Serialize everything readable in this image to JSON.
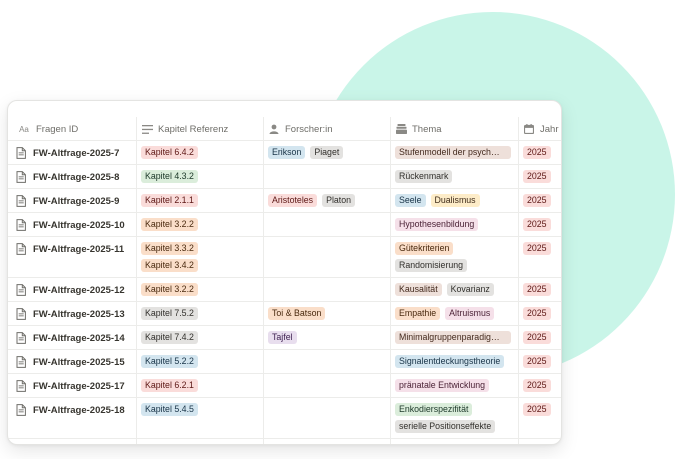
{
  "colors": {
    "accent_blob": "#c9f5e8",
    "red": "#fadcda",
    "green": "#dbeddb",
    "orange": "#fadec9",
    "yellow": "#fdecc8",
    "gray": "#e3e2e0",
    "blue": "#d3e5ef",
    "brown": "#eee0da",
    "pink": "#f5e0e9",
    "purple": "#e8deee"
  },
  "columns": [
    {
      "key": "fragen_id",
      "label": "Fragen ID",
      "icon": "text-type-icon",
      "glyph": "Aa"
    },
    {
      "key": "kapitel",
      "label": "Kapitel Referenz",
      "icon": "lines-icon",
      "glyph": "≡"
    },
    {
      "key": "forscher",
      "label": "Forscher:in",
      "icon": "person-icon",
      "glyph": ""
    },
    {
      "key": "thema",
      "label": "Thema",
      "icon": "stack-icon",
      "glyph": ""
    },
    {
      "key": "jahr",
      "label": "Jahr",
      "icon": "calendar-icon",
      "glyph": ""
    }
  ],
  "rows": [
    {
      "id": "FW-Altfrage-2025-7",
      "kapitel": [
        {
          "label": "Kapitel 6.4.2",
          "color": "red"
        }
      ],
      "forscher": [
        {
          "label": "Erikson",
          "color": "blue"
        },
        {
          "label": "Piaget",
          "color": "gray"
        }
      ],
      "thema": [
        [
          {
            "label": "Stufenmodell der psych…",
            "color": "brown",
            "w": 116
          }
        ]
      ],
      "jahr": "2025"
    },
    {
      "id": "FW-Altfrage-2025-8",
      "kapitel": [
        {
          "label": "Kapitel 4.3.2",
          "color": "green"
        }
      ],
      "forscher": [],
      "thema": [
        [
          {
            "label": "Rückenmark",
            "color": "gray"
          }
        ]
      ],
      "jahr": "2025"
    },
    {
      "id": "FW-Altfrage-2025-9",
      "kapitel": [
        {
          "label": "Kapitel 2.1.1",
          "color": "red"
        }
      ],
      "forscher": [
        {
          "label": "Aristoteles",
          "color": "red"
        },
        {
          "label": "Platon",
          "color": "gray"
        }
      ],
      "thema": [
        [
          {
            "label": "Seele",
            "color": "blue"
          },
          {
            "label": "Dualismus",
            "color": "yellow"
          }
        ]
      ],
      "jahr": "2025"
    },
    {
      "id": "FW-Altfrage-2025-10",
      "kapitel": [
        {
          "label": "Kapitel 3.2.2",
          "color": "orange"
        }
      ],
      "forscher": [],
      "thema": [
        [
          {
            "label": "Hypothesenbildung",
            "color": "pink"
          }
        ]
      ],
      "jahr": "2025"
    },
    {
      "id": "FW-Altfrage-2025-11",
      "kapitel": [
        {
          "label": "Kapitel 3.3.2",
          "color": "orange"
        },
        {
          "label": "Kapitel 3.4.2",
          "color": "orange"
        }
      ],
      "forscher": [],
      "thema": [
        [
          {
            "label": "Gütekriterien",
            "color": "orange"
          }
        ],
        [
          {
            "label": "Randomisierung",
            "color": "gray"
          }
        ]
      ],
      "jahr": "2025"
    },
    {
      "id": "FW-Altfrage-2025-12",
      "kapitel": [
        {
          "label": "Kapitel 3.2.2",
          "color": "orange"
        }
      ],
      "forscher": [],
      "thema": [
        [
          {
            "label": "Kausalität",
            "color": "brown"
          },
          {
            "label": "Kovarianz",
            "color": "gray"
          }
        ]
      ],
      "jahr": "2025"
    },
    {
      "id": "FW-Altfrage-2025-13",
      "kapitel": [
        {
          "label": "Kapitel 7.5.2",
          "color": "gray"
        }
      ],
      "forscher": [
        {
          "label": "Toi & Batson",
          "color": "orange"
        }
      ],
      "thema": [
        [
          {
            "label": "Empathie",
            "color": "orange"
          },
          {
            "label": "Altruismus",
            "color": "pink"
          }
        ]
      ],
      "jahr": "2025"
    },
    {
      "id": "FW-Altfrage-2025-14",
      "kapitel": [
        {
          "label": "Kapitel 7.4.2",
          "color": "gray"
        }
      ],
      "forscher": [
        {
          "label": "Tajfel",
          "color": "purple"
        }
      ],
      "thema": [
        [
          {
            "label": "Minimalgruppenparadig…",
            "color": "brown",
            "w": 116
          }
        ]
      ],
      "jahr": "2025"
    },
    {
      "id": "FW-Altfrage-2025-15",
      "kapitel": [
        {
          "label": "Kapitel 5.2.2",
          "color": "blue"
        }
      ],
      "forscher": [],
      "thema": [
        [
          {
            "label": "Signalentdeckungstheorie",
            "color": "blue"
          }
        ]
      ],
      "jahr": "2025"
    },
    {
      "id": "FW-Altfrage-2025-17",
      "kapitel": [
        {
          "label": "Kapitel 6.2.1",
          "color": "red"
        }
      ],
      "forscher": [],
      "thema": [
        [
          {
            "label": "pränatale Entwicklung",
            "color": "pink"
          }
        ]
      ],
      "jahr": "2025"
    },
    {
      "id": "FW-Altfrage-2025-18",
      "kapitel": [
        {
          "label": "Kapitel 5.4.5",
          "color": "blue"
        }
      ],
      "forscher": [],
      "thema": [
        [
          {
            "label": "Enkodierspezifität",
            "color": "green"
          }
        ],
        [
          {
            "label": "serielle Positionseffekte",
            "color": "gray"
          }
        ]
      ],
      "jahr": "2025"
    }
  ]
}
